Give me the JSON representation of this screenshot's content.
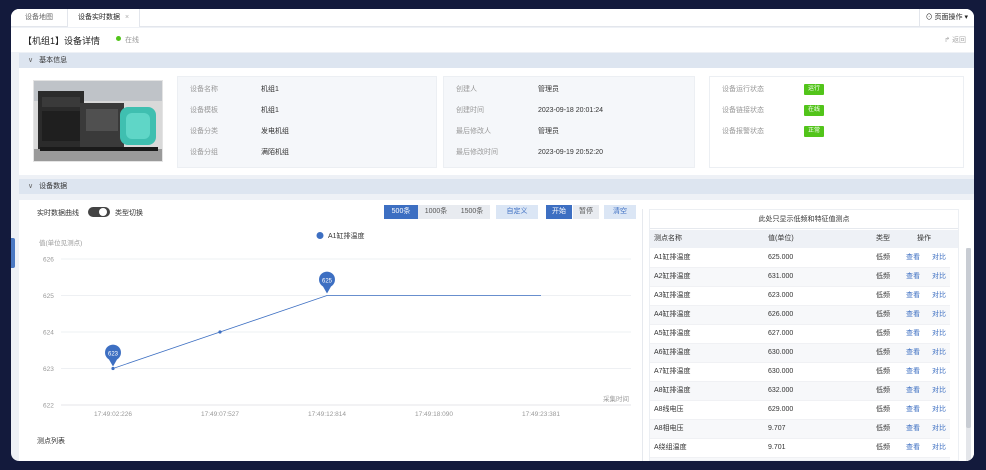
{
  "tabs": [
    {
      "label": "设备地图",
      "active": false
    },
    {
      "label": "设备实时数据",
      "active": true
    }
  ],
  "page_ops": {
    "label": "页面操作"
  },
  "header": {
    "title": "【机组1】设备详情",
    "status": "在线",
    "back": "返回"
  },
  "basic_section": {
    "title": "基本信息"
  },
  "info_card_1": [
    {
      "label": "设备名称",
      "value": "机组1"
    },
    {
      "label": "设备模板",
      "value": "机组1"
    },
    {
      "label": "设备分类",
      "value": "发电机组"
    },
    {
      "label": "设备分组",
      "value": "满陌机组"
    }
  ],
  "info_card_2": [
    {
      "label": "创建人",
      "value": "管理员"
    },
    {
      "label": "创建时间",
      "value": "2023-09-18 20:01:24"
    },
    {
      "label": "最后修改人",
      "value": "管理员"
    },
    {
      "label": "最后修改时间",
      "value": "2023-09-19 20:52:20"
    }
  ],
  "status_card": [
    {
      "label": "设备运行状态",
      "value": "运行"
    },
    {
      "label": "设备链接状态",
      "value": "在线"
    },
    {
      "label": "设备报警状态",
      "value": "正常"
    }
  ],
  "data_section": {
    "title": "设备数据"
  },
  "controls": {
    "realtime_label": "实时数据曲线",
    "type_switch_label": "类型切换",
    "range_buttons": [
      "500条",
      "1000条",
      "1500条"
    ],
    "custom_button": "自定义",
    "start_button": "开始",
    "pause_button": "暂停",
    "clear_button": "清空",
    "point_list_label": "测点列表"
  },
  "colors": {
    "accent": "#3d6fc2",
    "success": "#52c41a"
  },
  "chart_data": {
    "type": "line",
    "ylabel": "值(单位见测点)",
    "xlabel": "采集时间",
    "ylim": [
      622,
      626
    ],
    "yticks": [
      "626",
      "625",
      "624",
      "623",
      "622"
    ],
    "xticks": [
      "17:49:02:226",
      "17:49:07:527",
      "17:49:12:814",
      "17:49:18:090",
      "17:49:23:381"
    ],
    "series": [
      {
        "name": "A1缸排温度",
        "points": [
          {
            "x": "17:49:02:226",
            "y": 623
          },
          {
            "x": "17:49:07:527",
            "y": 624
          },
          {
            "x": "17:49:12:814",
            "y": 625
          },
          {
            "x": "17:49:18:090",
            "y": 625
          },
          {
            "x": "17:49:23:381",
            "y": 625
          }
        ]
      }
    ],
    "annotations": [
      {
        "x": "17:49:02:226",
        "label": "623"
      },
      {
        "x": "17:49:12:814",
        "label": "625"
      }
    ]
  },
  "table": {
    "caption": "此处只显示低频和特征值测点",
    "headers": [
      "测点名称",
      "值(单位)",
      "类型",
      "操作"
    ],
    "rows": [
      {
        "name": "A1缸排温度",
        "value": "625.000",
        "type": "低频",
        "view": "查看",
        "compare": "对比"
      },
      {
        "name": "A2缸排温度",
        "value": "631.000",
        "type": "低频",
        "view": "查看",
        "compare": "对比"
      },
      {
        "name": "A3缸排温度",
        "value": "623.000",
        "type": "低频",
        "view": "查看",
        "compare": "对比"
      },
      {
        "name": "A4缸排温度",
        "value": "626.000",
        "type": "低频",
        "view": "查看",
        "compare": "对比"
      },
      {
        "name": "A5缸排温度",
        "value": "627.000",
        "type": "低频",
        "view": "查看",
        "compare": "对比"
      },
      {
        "name": "A6缸排温度",
        "value": "630.000",
        "type": "低频",
        "view": "查看",
        "compare": "对比"
      },
      {
        "name": "A7缸排温度",
        "value": "630.000",
        "type": "低频",
        "view": "查看",
        "compare": "对比"
      },
      {
        "name": "A8缸排温度",
        "value": "632.000",
        "type": "低频",
        "view": "查看",
        "compare": "对比"
      },
      {
        "name": "A8线电压",
        "value": "629.000",
        "type": "低频",
        "view": "查看",
        "compare": "对比"
      },
      {
        "name": "A8相电压",
        "value": "9.707",
        "type": "低频",
        "view": "查看",
        "compare": "对比"
      },
      {
        "name": "A绕组温度",
        "value": "9.701",
        "type": "低频",
        "view": "查看",
        "compare": "对比"
      },
      {
        "name": "A相电流",
        "value": "22.600",
        "type": "低频",
        "view": "查看",
        "compare": "对比"
      }
    ]
  }
}
